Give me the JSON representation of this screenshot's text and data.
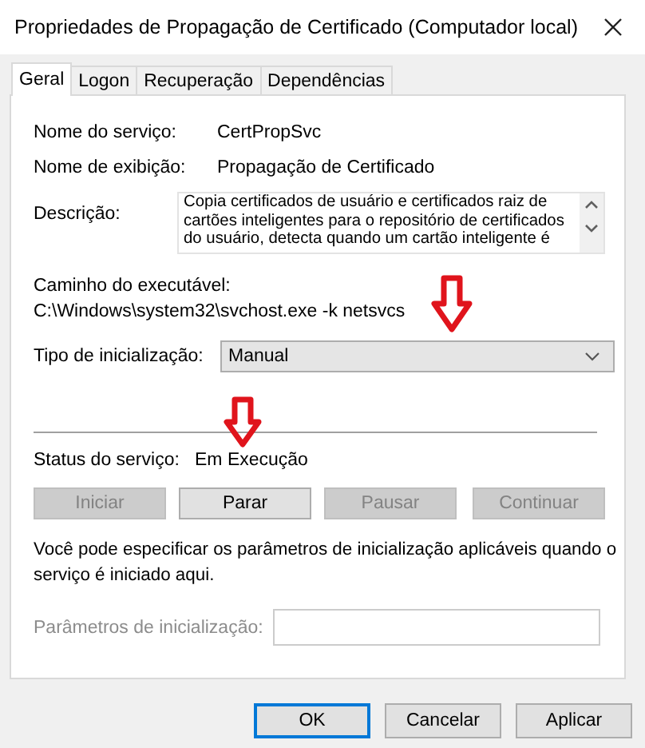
{
  "window": {
    "title": "Propriedades de Propagação de Certificado (Computador local)"
  },
  "tabs": [
    {
      "label": "Geral",
      "selected": true
    },
    {
      "label": "Logon",
      "selected": false
    },
    {
      "label": "Recuperação",
      "selected": false
    },
    {
      "label": "Dependências",
      "selected": false
    }
  ],
  "service_name": {
    "label": "Nome do serviço:",
    "value": "CertPropSvc"
  },
  "display_name": {
    "label": "Nome de exibição:",
    "value": "Propagação de Certificado"
  },
  "description": {
    "label": "Descrição:",
    "lines": [
      "Copia certificados de usuário e certificados raiz de",
      "cartões inteligentes para o repositório de certificados",
      "do usuário, detecta quando um cartão inteligente é"
    ]
  },
  "executable_path": {
    "label": "Caminho do executável:",
    "value": "C:\\Windows\\system32\\svchost.exe -k netsvcs"
  },
  "startup_type": {
    "label": "Tipo de inicialização:",
    "value": "Manual"
  },
  "service_status": {
    "label": "Status do serviço:",
    "value": "Em Execução"
  },
  "control_buttons": [
    {
      "label": "Iniciar",
      "disabled": true
    },
    {
      "label": "Parar",
      "disabled": false
    },
    {
      "label": "Pausar",
      "disabled": true
    },
    {
      "label": "Continuar",
      "disabled": true
    }
  ],
  "hint": "Você pode especificar os parâmetros de inicialização aplicáveis quando o serviço é iniciado aqui.",
  "start_parameters": {
    "label": "Parâmetros de inicialização:",
    "disabled": true
  },
  "dialog_buttons": [
    {
      "label": "OK",
      "default": true
    },
    {
      "label": "Cancelar",
      "default": false
    },
    {
      "label": "Aplicar",
      "default": false
    }
  ]
}
